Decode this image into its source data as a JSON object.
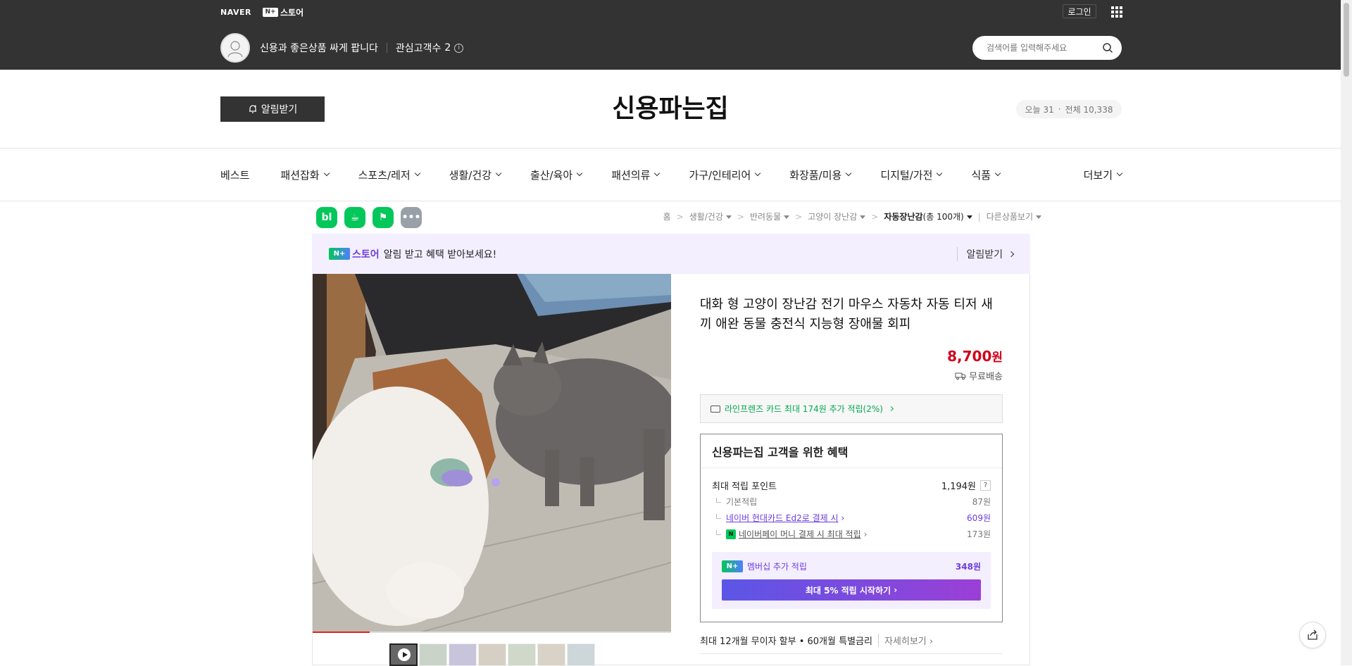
{
  "topbar": {
    "naver": "NAVER",
    "store_badge": "N+",
    "store_label": "스토어",
    "login": "로그인",
    "store_desc": "신용과 좋은상품 싸게 팝니다",
    "interest_label": "관심고객수",
    "interest_count": "2",
    "info_icon": "i"
  },
  "search": {
    "placeholder": "검색어를 입력해주세요"
  },
  "header": {
    "alarm_label": "알림받기",
    "store_title": "신용파는집",
    "today_label": "오늘",
    "today_value": "31",
    "total_label": "전체",
    "total_value": "10,338"
  },
  "nav": {
    "items": [
      "베스트",
      "패션잡화",
      "스포츠/레저",
      "생활/건강",
      "출산/육아",
      "패션의류",
      "가구/인테리어",
      "화장품/미용",
      "디지털/가전",
      "식품"
    ],
    "more": "더보기"
  },
  "sns": [
    {
      "label": "bl",
      "color": "#03c75a",
      "icon": "blog-icon"
    },
    {
      "label": "☕",
      "color": "#03c75a",
      "icon": "cafe-icon"
    },
    {
      "label": "⚑",
      "color": "#03c75a",
      "icon": "bookmark-icon"
    },
    {
      "label": "•••",
      "color": "#9aa0a8",
      "icon": "more-icon"
    }
  ],
  "breadcrumb": {
    "home": "홈",
    "c1": "생활/건강",
    "c2": "반려동물",
    "c3": "고양이 장난감",
    "c4_name": "자동장난감",
    "c4_count": "(총 100개)",
    "other": "다른상품보기"
  },
  "promo": {
    "badge": "N+",
    "logo": "스토어",
    "text": "알림 받고 혜택 받아보세요!",
    "link": "알림받기"
  },
  "product": {
    "title": "대화 형 고양이 장난감 전기 마우스 자동차 자동 티저 새끼 애완 동물 충전식 지능형 장애물 회피",
    "price": "8,700",
    "price_unit": "원",
    "shipping": "무료배송",
    "video_progress": 0.16,
    "thumb_count": 7
  },
  "card_benefit": "라인프렌즈 카드 최대 174원 추가 적립(2%)",
  "benefits": {
    "title": "신용파는집 고객을 위한 혜택",
    "max_label": "최대 적립 포인트",
    "max_value": "1,194원",
    "q": "?",
    "basic_label": "기본적립",
    "basic_value": "87원",
    "card_label": "네이버 현대카드 Ed2로 결제 시",
    "card_value": "609원",
    "npay_label": "네이버페이 머니 결제 시 최대 적립",
    "npay_value": "173원",
    "npay_badge": "N",
    "member_badge": "N+",
    "member_label": "멤버십 추가 적립",
    "member_value": "348원",
    "member_btn": "최대 5% 적립 시작하기"
  },
  "installment": {
    "text": "최대 12개월 무이자 할부 • 60개월 특별금리",
    "more": "자세히보기"
  },
  "colors": {
    "topbar": "#333333",
    "price": "#d0021b",
    "naver_green": "#03c75a",
    "purple": "#6d3ddf"
  }
}
